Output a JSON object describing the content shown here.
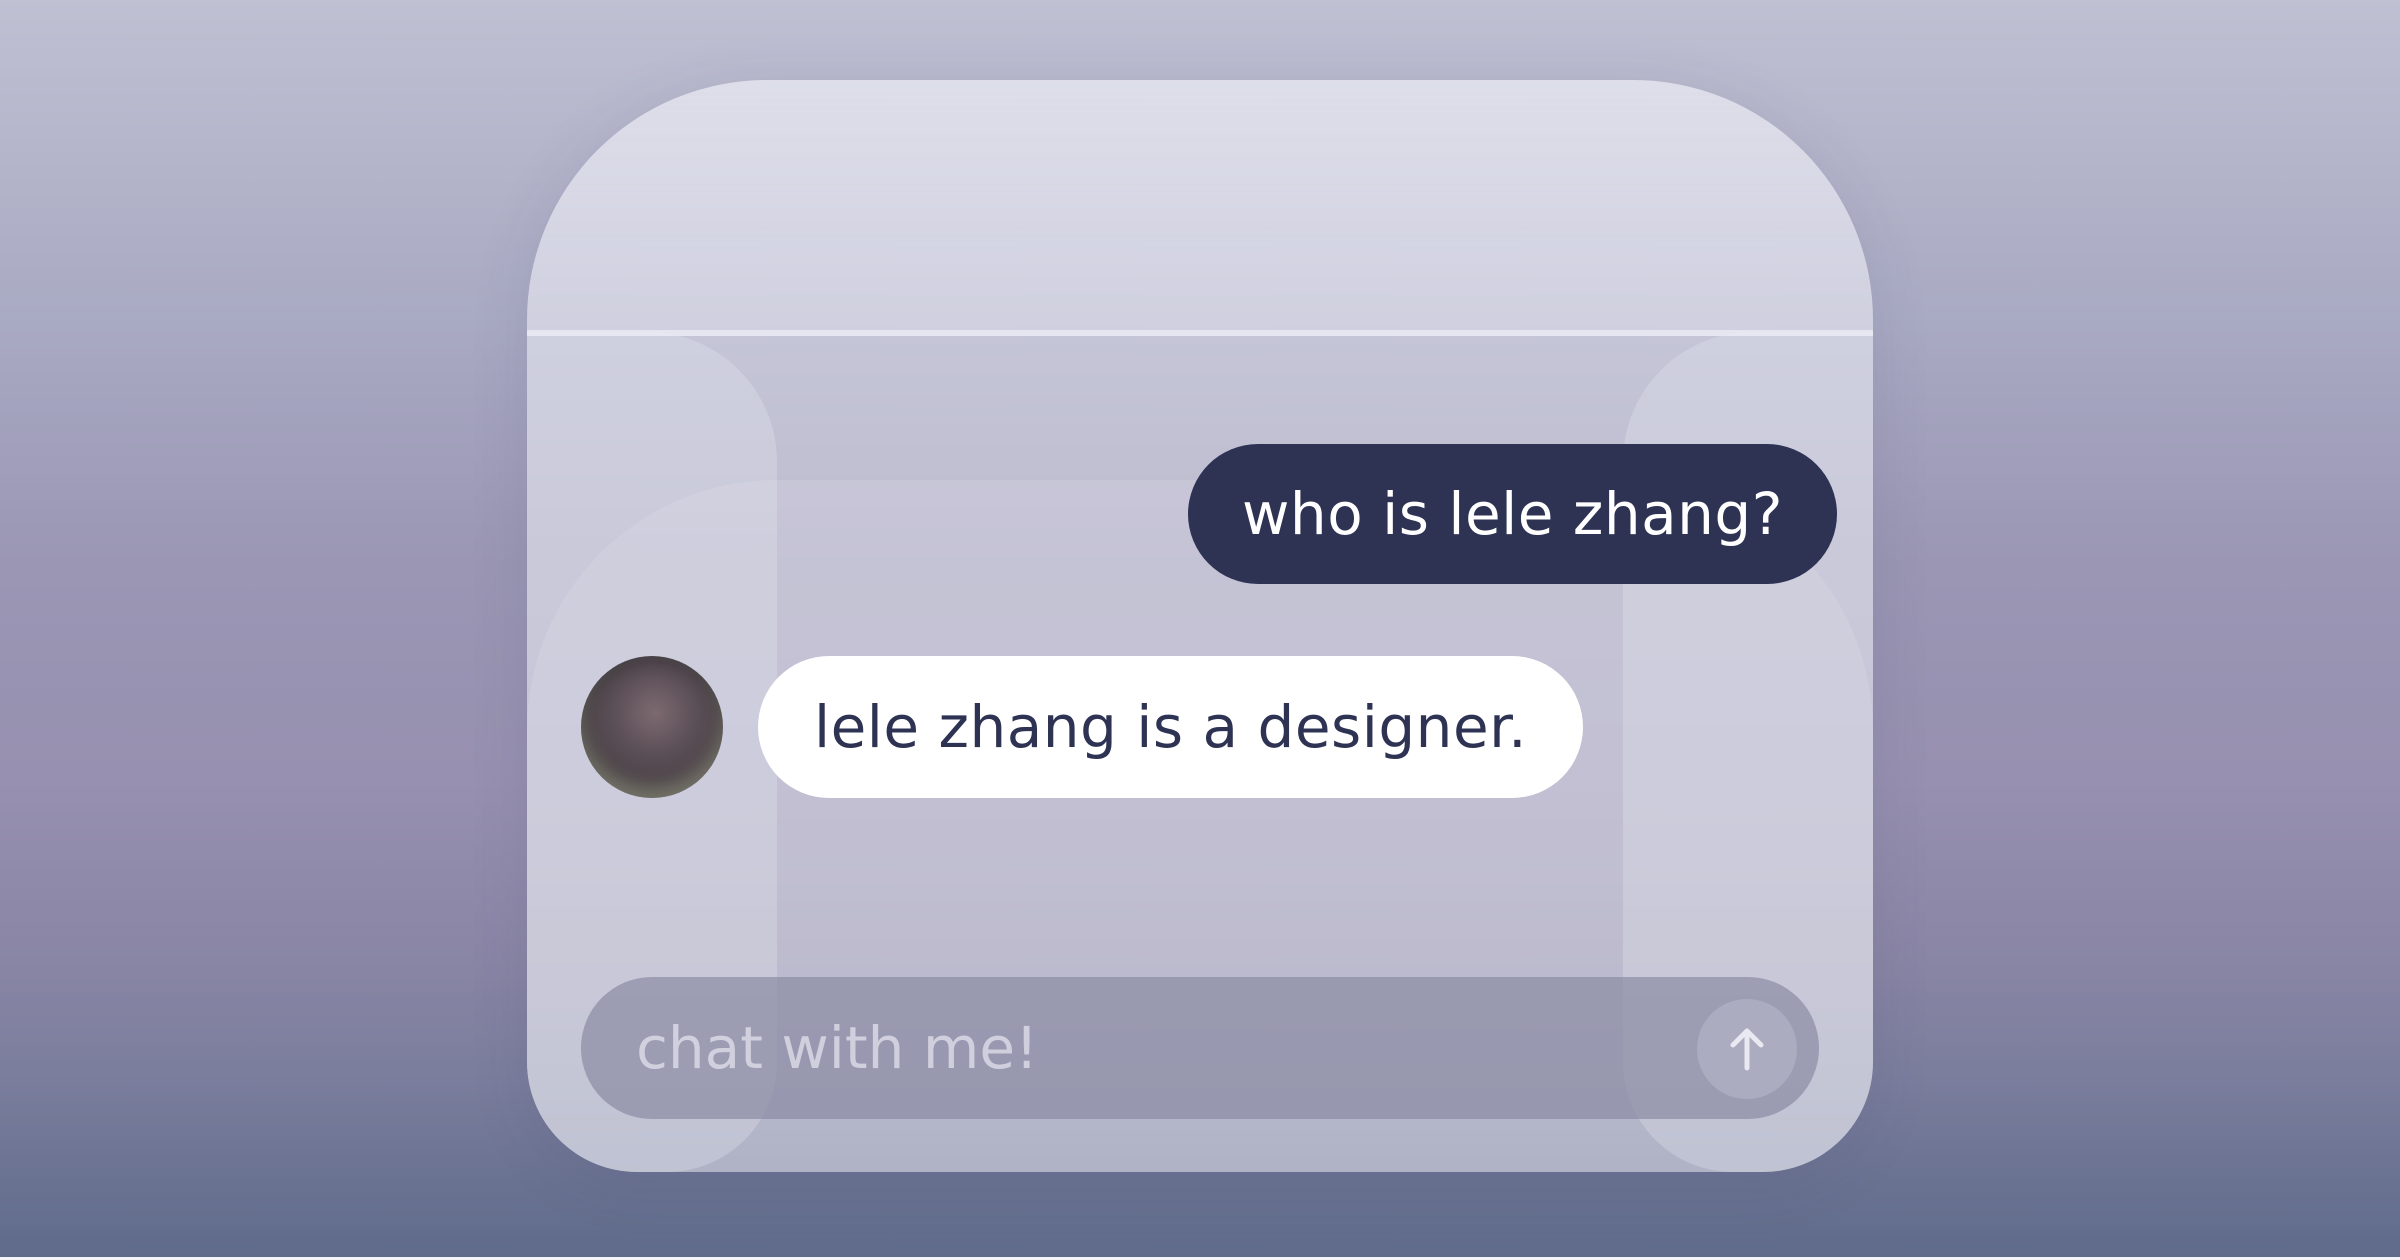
{
  "chat": {
    "messages": [
      {
        "role": "user",
        "text": "who is lele zhang?"
      },
      {
        "role": "assistant",
        "text": "lele zhang is a designer."
      }
    ],
    "input": {
      "value": "",
      "placeholder": "chat with me!"
    },
    "send_icon": "arrow-up-icon"
  },
  "colors": {
    "user_bubble": "#2e3354",
    "assistant_bubble": "#ffffff",
    "text_dark": "#2e3354"
  }
}
